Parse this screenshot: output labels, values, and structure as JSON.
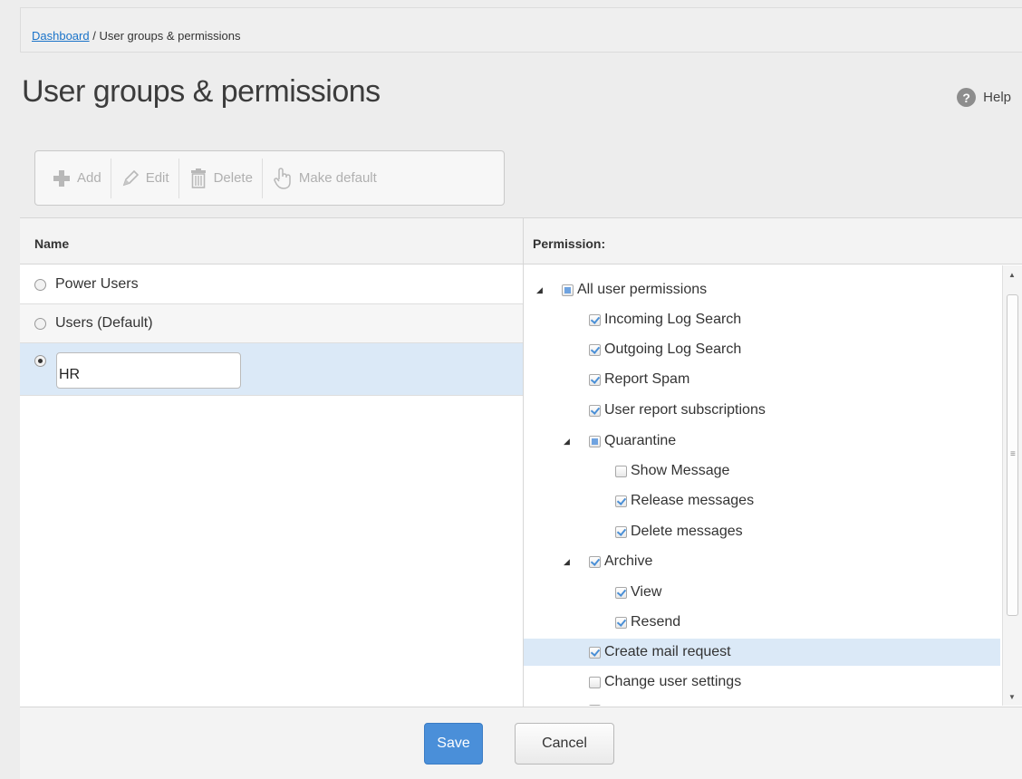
{
  "breadcrumb": {
    "link": "Dashboard",
    "separator": " / ",
    "current": "User groups & permissions"
  },
  "page": {
    "title": "User groups & permissions",
    "help_label": "Help",
    "help_icon": "?"
  },
  "toolbar": {
    "add": "Add",
    "edit": "Edit",
    "delete": "Delete",
    "make_default": "Make default"
  },
  "table": {
    "name_header": "Name",
    "permission_header": "Permission:"
  },
  "groups": [
    {
      "name": "Power Users",
      "selected": false
    },
    {
      "name": "Users (Default)",
      "selected": false
    },
    {
      "name": "HR",
      "selected": true,
      "editing": true
    }
  ],
  "permissions": [
    {
      "label": "All user permissions",
      "state": "partial"
    },
    {
      "label": "Incoming Log Search",
      "state": "checked"
    },
    {
      "label": "Outgoing Log Search",
      "state": "checked"
    },
    {
      "label": "Report Spam",
      "state": "checked"
    },
    {
      "label": "User report subscriptions",
      "state": "checked"
    },
    {
      "label": "Quarantine",
      "state": "partial"
    },
    {
      "label": "Show Message",
      "state": "unchecked"
    },
    {
      "label": "Release messages",
      "state": "checked"
    },
    {
      "label": "Delete messages",
      "state": "checked"
    },
    {
      "label": "Archive",
      "state": "checked"
    },
    {
      "label": "View",
      "state": "checked"
    },
    {
      "label": "Resend",
      "state": "checked"
    },
    {
      "label": "Create mail request",
      "state": "checked"
    },
    {
      "label": "Change user settings",
      "state": "unchecked"
    }
  ],
  "footer": {
    "save": "Save",
    "cancel": "Cancel"
  },
  "colors": {
    "accent": "#4a8fd9",
    "selection": "#dbe9f7",
    "link": "#1a73c9"
  }
}
